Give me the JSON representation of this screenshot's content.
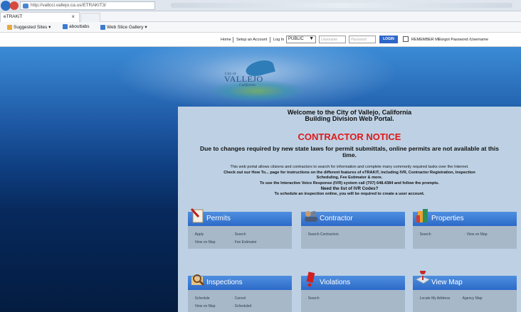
{
  "browser": {
    "url": "http://vallcci.vallejo.ca.us/ETRAKIT3/",
    "tab_title": "eTRAKiT",
    "tab_close": "×",
    "favorites": [
      "Suggested Sites ▾",
      "abouttabs",
      "Web Slice Gallery ▾"
    ]
  },
  "topbar": {
    "home": "Home",
    "setup": "Setup an Account",
    "login_label": "Log In",
    "login_type": "PUBLIC",
    "username_placeholder": "Username",
    "password_placeholder": "Password",
    "login_button": "LOGIN",
    "remember": "REMEMBER ME",
    "forgot": "Forgot Password /Username"
  },
  "logo": {
    "city_of": "City of",
    "name": "VALLEJO",
    "state": "California"
  },
  "welcome": {
    "line1": "Welcome to the City of Vallejo, California",
    "line2": "Building Division Web Portal."
  },
  "notice": {
    "title": "CONTRACTOR NOTICE",
    "line1": "Due to changes required by new state laws for permit submittals, online permits are not available at this",
    "line2": "time."
  },
  "info": {
    "l1": "This web portal allows citizens and contractors to search for information and complete many commonly required tasks over the Internet.",
    "l2": "Check out our How To... page for instructions on the different features of eTRAKiT, including IVR, Contractor Registration, Inspection",
    "l3": "Scheduling, Fee Estimator & more.",
    "l4": "To use the Interactive Voice Response (IVR) system call (707) 648.4384 and follow the prompts.",
    "l5": "Need the list of IVR Codes?",
    "l6": "To schedule an inspection online, you will be required to create a user account."
  },
  "modules": {
    "permits": {
      "title": "Permits",
      "links": [
        "Apply",
        "Search",
        "View on Map",
        "Fee Estimator"
      ]
    },
    "contractor": {
      "title": "Contractor",
      "links": [
        "Search Contractors"
      ]
    },
    "properties": {
      "title": "Properties",
      "links": [
        "Search",
        "View on Map"
      ]
    },
    "inspections": {
      "title": "Inspections",
      "links": [
        "Schedule",
        "Cancel",
        "View on Map",
        "Scheduled"
      ]
    },
    "violations": {
      "title": "Violations",
      "links": [
        "Search"
      ]
    },
    "viewmap": {
      "title": "View Map",
      "links": [
        "Locate My Address",
        "Agency Map"
      ]
    }
  }
}
